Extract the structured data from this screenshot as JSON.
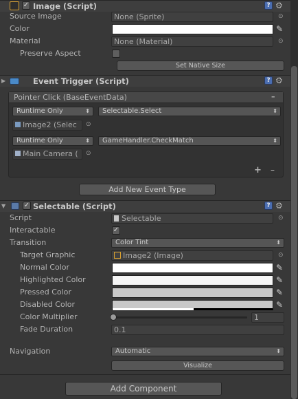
{
  "image_component": {
    "title": "Image (Script)",
    "enabled": true,
    "source_image_label": "Source Image",
    "source_image_value": "None (Sprite)",
    "color_label": "Color",
    "material_label": "Material",
    "material_value": "None (Material)",
    "preserve_aspect_label": "Preserve Aspect",
    "set_native_size_label": "Set Native Size"
  },
  "event_trigger": {
    "title": "Event Trigger (Script)",
    "entry_title": "Pointer Click (BaseEventData)",
    "remove_entry_label": "–",
    "calls": [
      {
        "mode": "Runtime Only",
        "function": "Selectable.Select",
        "target": "Image2 (Selec"
      },
      {
        "mode": "Runtime Only",
        "function": "GameHandler.CheckMatch",
        "target": "Main Camera ("
      }
    ],
    "add_call_label": "+",
    "remove_call_label": "–",
    "add_new_event_label": "Add New Event Type"
  },
  "selectable": {
    "title": "Selectable (Script)",
    "enabled": true,
    "script_label": "Script",
    "script_value": "Selectable",
    "interactable_label": "Interactable",
    "interactable_checked": true,
    "transition_label": "Transition",
    "transition_value": "Color Tint",
    "target_graphic_label": "Target Graphic",
    "target_graphic_value": "Image2 (Image)",
    "normal_color_label": "Normal Color",
    "highlighted_color_label": "Highlighted Color",
    "pressed_color_label": "Pressed Color",
    "disabled_color_label": "Disabled Color",
    "color_multiplier_label": "Color Multiplier",
    "color_multiplier_value": "1",
    "fade_duration_label": "Fade Duration",
    "fade_duration_value": "0.1",
    "navigation_label": "Navigation",
    "navigation_value": "Automatic",
    "visualize_label": "Visualize"
  },
  "add_component_label": "Add Component",
  "colors": {
    "normal": "#ffffff",
    "highlighted": "#f5f5f5",
    "pressed": "#c8c8c8",
    "disabled": "#c8c8c8",
    "image_color": "#ffffff"
  }
}
